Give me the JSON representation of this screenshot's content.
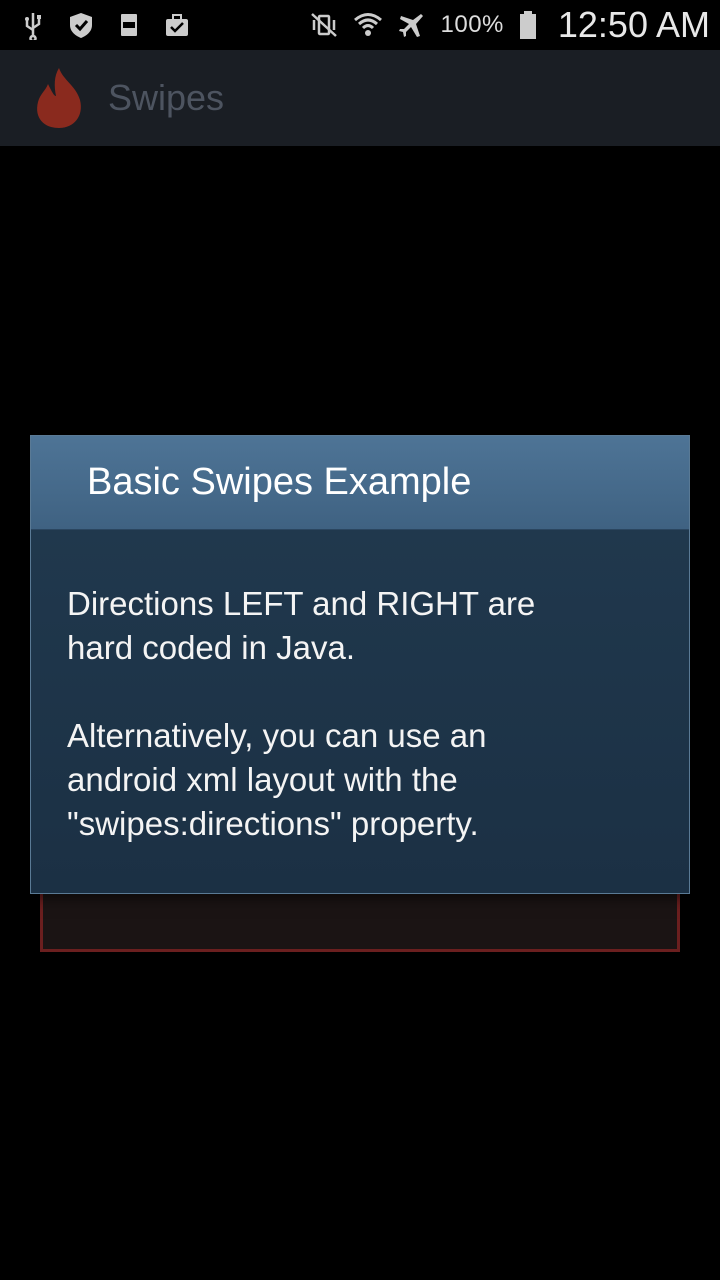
{
  "status_bar": {
    "icons_left": [
      "usb-icon",
      "shield-icon",
      "storage-icon",
      "briefcase-icon"
    ],
    "icons_right": [
      "vibrate-mute-icon",
      "wifi-icon",
      "airplane-icon",
      "battery-icon"
    ],
    "battery_percent": "100%",
    "time": "12:50 AM"
  },
  "action_bar": {
    "title": "Swipes",
    "logo_icon": "flame-icon"
  },
  "dialog": {
    "title": "Basic Swipes Example",
    "paragraph_1": "Directions LEFT and RIGHT are\nhard coded in Java.",
    "paragraph_2": "Alternatively, you can use an\nandroid xml layout with the\n\"swipes:directions\" property."
  },
  "colors": {
    "dialog_header": "#4e7496",
    "dialog_body": "#1e3448",
    "card_border": "#6b1f1f",
    "flame": "#8a2a1e"
  }
}
